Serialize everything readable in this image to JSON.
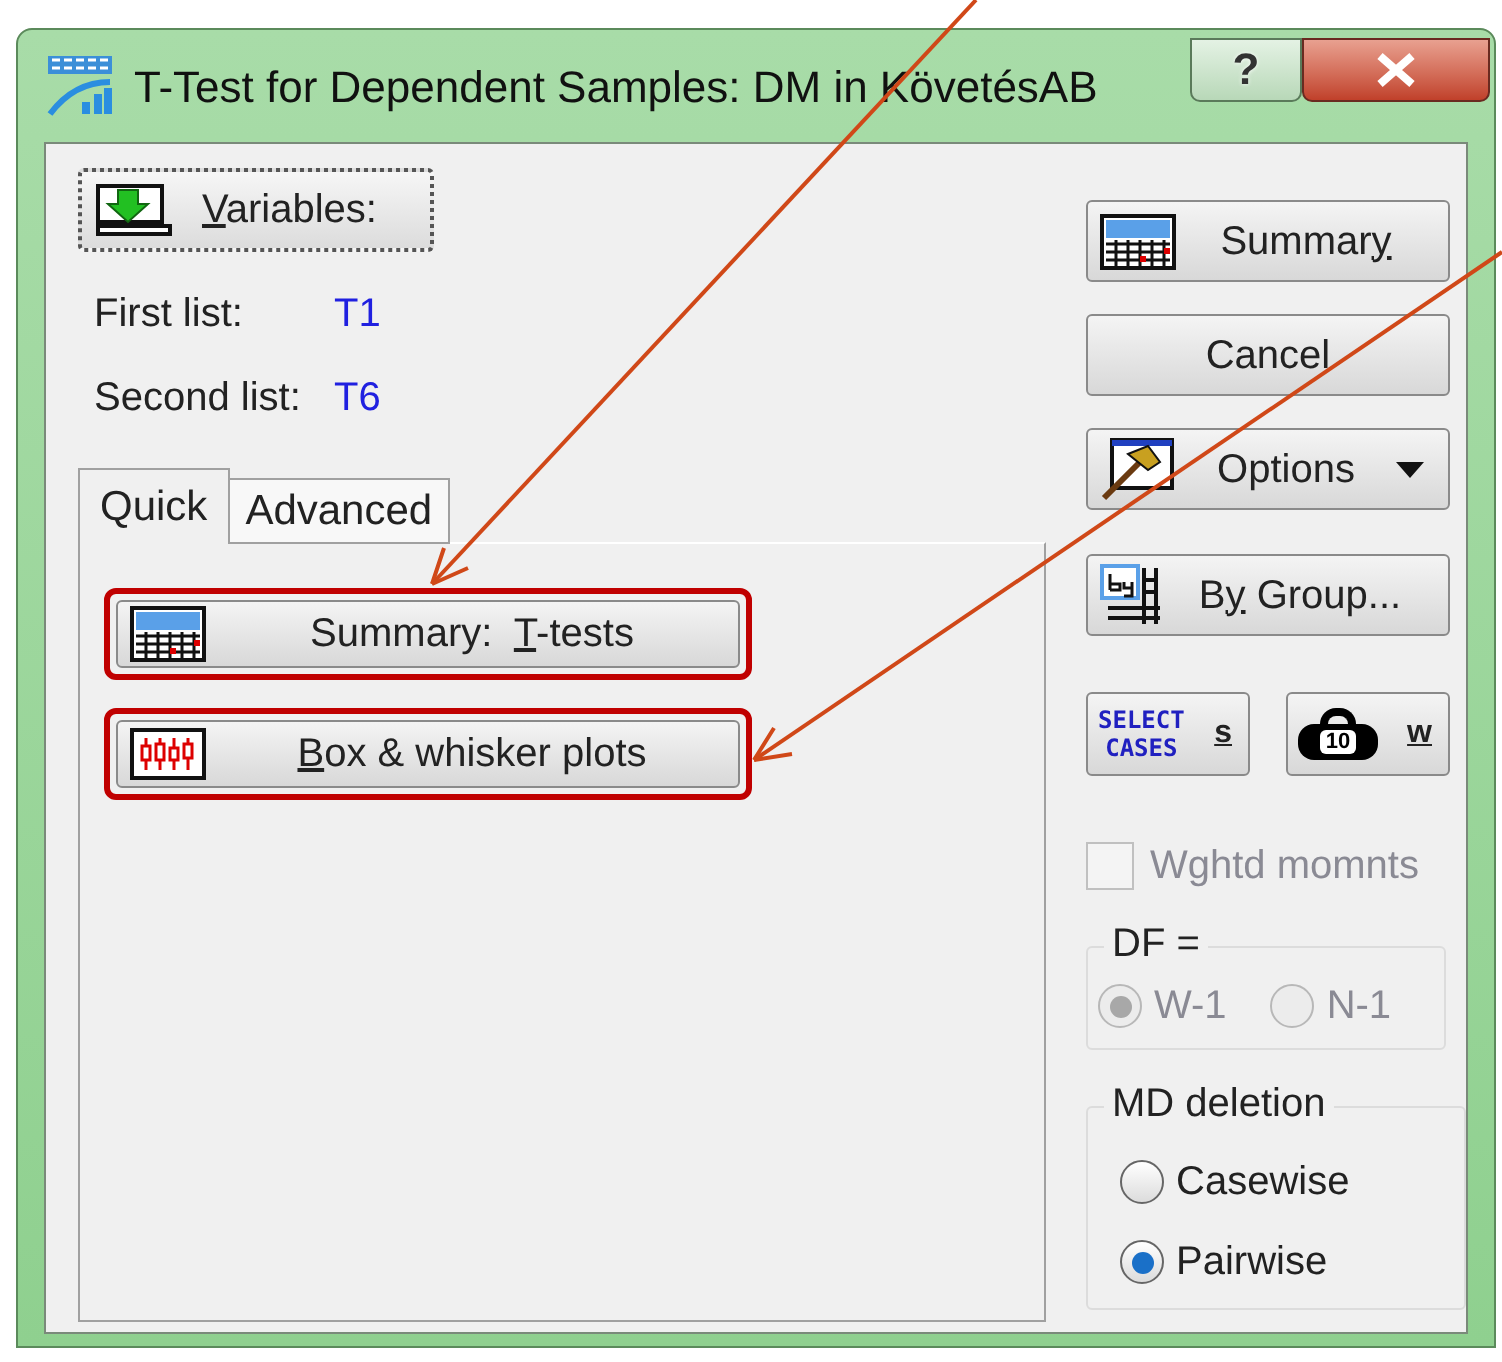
{
  "window": {
    "title": "T-Test for Dependent Samples: DM in KövetésAB",
    "help_button": "?"
  },
  "variables_button": {
    "label_parts": [
      {
        "text": "V",
        "underlined": true
      },
      {
        "text": "ariables:",
        "underlined": false
      }
    ]
  },
  "lists": [
    {
      "label": "First list:",
      "value": "T1"
    },
    {
      "label": "Second list:",
      "value": "T6"
    }
  ],
  "tabs": [
    {
      "label": "Quick",
      "selected": true
    },
    {
      "label": "Advanced",
      "selected": false
    }
  ],
  "quick_buttons": [
    {
      "kind": "summary",
      "label_parts": [
        {
          "text": "Summary:  ",
          "underlined": false
        },
        {
          "text": "T",
          "underlined": true
        },
        {
          "text": "-tests",
          "underlined": false
        }
      ],
      "highlighted": true
    },
    {
      "kind": "boxplot",
      "label_parts": [
        {
          "text": "B",
          "underlined": true
        },
        {
          "text": "ox & whisker plots",
          "underlined": false
        }
      ],
      "highlighted": true
    }
  ],
  "side_buttons": [
    {
      "kind": "summary",
      "label_parts": [
        {
          "text": "Summar",
          "underlined": false
        },
        {
          "text": "y",
          "underlined": true
        }
      ]
    },
    {
      "kind": "plain",
      "label_parts": [
        {
          "text": "Cancel",
          "underlined": false
        }
      ]
    },
    {
      "kind": "options",
      "label_parts": [
        {
          "text": "Options",
          "underlined": false
        }
      ]
    },
    {
      "kind": "bygroup",
      "label_parts": [
        {
          "text": "B",
          "underlined": false
        },
        {
          "text": "y",
          "underlined": true
        },
        {
          "text": " Group...",
          "underlined": false
        }
      ]
    }
  ],
  "small_buttons": [
    {
      "kind": "select_cases",
      "icon_text": [
        "SELECT",
        "CASES"
      ],
      "label_parts": [
        {
          "text": "s",
          "underlined": true
        }
      ]
    },
    {
      "kind": "weight",
      "icon_text": [
        "10"
      ],
      "label_parts": [
        {
          "text": "w",
          "underlined": true
        }
      ]
    }
  ],
  "weighted_moments": {
    "label": "Wghtd momnts",
    "checked": false,
    "disabled": true
  },
  "df_group": {
    "title": "DF =",
    "disabled": true,
    "options": [
      {
        "label": "W-1",
        "selected": true
      },
      {
        "label": "N-1",
        "selected": false
      }
    ]
  },
  "md_deletion": {
    "title": "MD deletion",
    "disabled": false,
    "options": [
      {
        "label": "Casewise",
        "selected": false
      },
      {
        "label": "Pairwise",
        "selected": true
      }
    ]
  }
}
